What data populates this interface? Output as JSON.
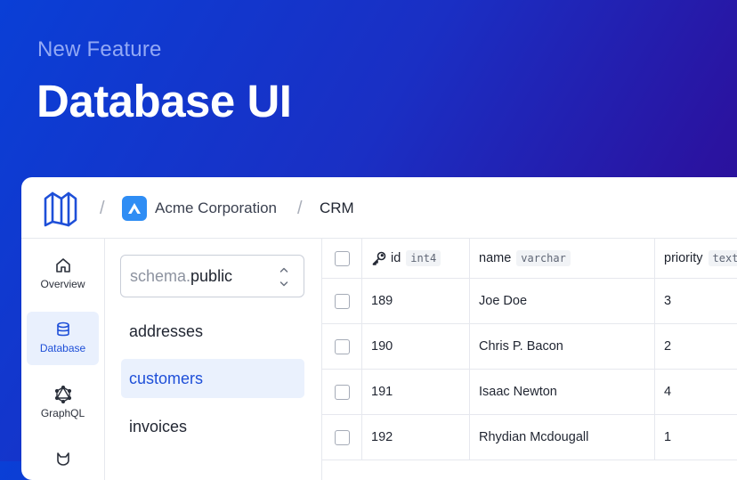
{
  "hero": {
    "eyebrow": "New Feature",
    "title": "Database UI"
  },
  "breadcrumb": {
    "separator": "/",
    "org": "Acme Corporation",
    "project": "CRM"
  },
  "nav": {
    "items": [
      {
        "label": "Overview",
        "icon": "home-icon",
        "active": false
      },
      {
        "label": "Database",
        "icon": "database-icon",
        "active": true
      },
      {
        "label": "GraphQL",
        "icon": "graphql-icon",
        "active": false
      },
      {
        "label": "",
        "icon": "hasura-icon",
        "active": false
      }
    ]
  },
  "schema": {
    "prefix": "schema.",
    "value": "public"
  },
  "tables": [
    {
      "name": "addresses",
      "active": false
    },
    {
      "name": "customers",
      "active": true
    },
    {
      "name": "invoices",
      "active": false
    }
  ],
  "grid": {
    "columns": [
      {
        "name": "id",
        "type": "int4",
        "primary_key": true
      },
      {
        "name": "name",
        "type": "varchar"
      },
      {
        "name": "priority",
        "type": "text"
      }
    ],
    "rows": [
      {
        "id": "189",
        "name": "Joe Doe",
        "priority": "3"
      },
      {
        "id": "190",
        "name": "Chris P. Bacon",
        "priority": "2"
      },
      {
        "id": "191",
        "name": "Isaac Newton",
        "priority": "4"
      },
      {
        "id": "192",
        "name": "Rhydian Mcdougall",
        "priority": "1"
      }
    ]
  },
  "colors": {
    "accent": "#1e4fd8",
    "active_bg": "#e9f0fd",
    "org_badge": "#2f8df4"
  }
}
